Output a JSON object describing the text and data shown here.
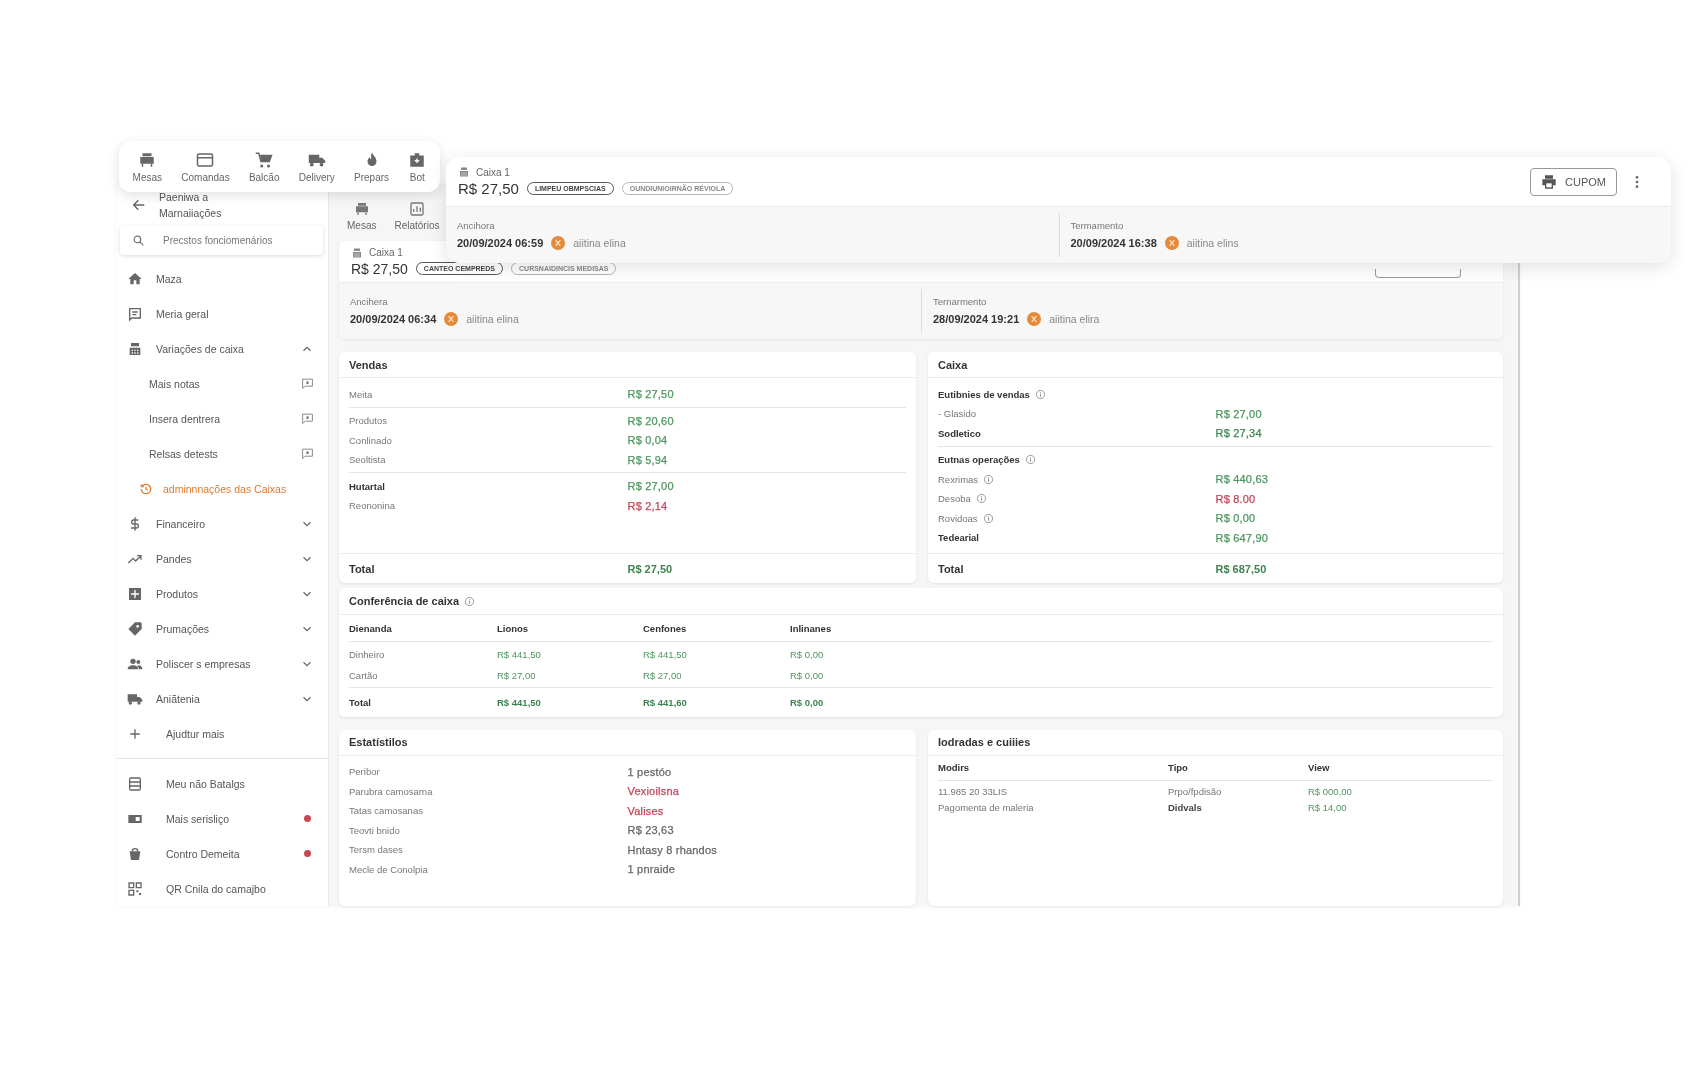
{
  "top_nav": {
    "items": [
      {
        "label": "Mesas"
      },
      {
        "label": "Comandas"
      },
      {
        "label": "Balcão"
      },
      {
        "label": "Delivery"
      },
      {
        "label": "Prepars"
      },
      {
        "label": "Bot"
      }
    ]
  },
  "cash_header": {
    "title": "Caixa 1",
    "amount": "R$ 27,50",
    "chips": [
      {
        "label": "LIMPEU OBMPSCIAS",
        "emphasis": true
      },
      {
        "label": "OUNDIUNIOIRNÃO RÉVIOLA",
        "emphasis": false
      }
    ],
    "print_button": "CUPOM",
    "opening": {
      "label": "Ancihora",
      "datetime": "20/09/2024 06:59",
      "user": "aiitina elina"
    },
    "closing": {
      "label": "Termamento",
      "datetime": "20/09/2024 16:38",
      "user": "aiitina elins"
    }
  },
  "sidebar": {
    "title": "Paeniwa a Marnaiiações",
    "search": {
      "placeholder": "Precstos fonciomenários"
    },
    "items": [
      {
        "kind": "link",
        "label": "Maza",
        "selected": false
      },
      {
        "kind": "link",
        "label": "Meria geral",
        "selected": false
      },
      {
        "kind": "group",
        "label": "Variações de caixa",
        "selected": false,
        "expanded": true,
        "children": [
          {
            "label": "Mais notas",
            "selected": false
          },
          {
            "label": "Insera dentrera",
            "selected": false
          },
          {
            "label": "Relsas detests",
            "selected": false
          },
          {
            "label": "adminnnações das Caixas",
            "selected": true
          }
        ]
      },
      {
        "kind": "group",
        "label": "Financeiro",
        "selected": false,
        "expanded": false
      },
      {
        "kind": "group",
        "label": "Pandes",
        "selected": false,
        "expanded": false
      },
      {
        "kind": "group",
        "label": "Produtos",
        "selected": false,
        "expanded": false
      },
      {
        "kind": "group",
        "label": "Prumações",
        "selected": false,
        "expanded": false
      },
      {
        "kind": "group",
        "label": "Poliscer s empresas",
        "selected": false,
        "expanded": false
      },
      {
        "kind": "group",
        "label": "Aniãtenia",
        "selected": false,
        "expanded": false
      },
      {
        "kind": "action",
        "label": "Ajudtur mais",
        "selected": false
      }
    ],
    "bottom_items": [
      {
        "label": "Meu não Batalgs",
        "alert": false
      },
      {
        "label": "Mais serisliço",
        "alert": true
      },
      {
        "label": "Contro Demeita",
        "alert": true
      },
      {
        "label": "QR Cnila do camajbo",
        "alert": false
      }
    ]
  },
  "sub_nav": {
    "items": [
      {
        "label": "Mesas"
      },
      {
        "label": "Relatórios"
      }
    ]
  },
  "cash_summary": {
    "title": "Caixa 1",
    "amount": "R$ 27,50",
    "chips": [
      {
        "label": "CANTEO CEMPREDS",
        "emphasis": true
      },
      {
        "label": "CURSNAIDINCIS MEDISAS",
        "emphasis": false
      }
    ],
    "opening": {
      "label": "Ancihera",
      "datetime": "20/09/2024 06:34",
      "user": "aiitina elina"
    },
    "closing": {
      "label": "Ternarmento",
      "datetime": "28/09/2024 19:21",
      "user": "aiitina elira"
    }
  },
  "sales": {
    "title": "Vendas",
    "groups": [
      {
        "rows": [
          {
            "kind": "row",
            "label": "Meita",
            "bold": false,
            "value": "R$ 27,50",
            "color": "#4f9560"
          }
        ]
      },
      {
        "rows": [
          {
            "kind": "row",
            "label": "Produtos",
            "bold": false,
            "value": "R$ 20,60",
            "color": "#4f9560"
          },
          {
            "kind": "row",
            "label": "Conlinado",
            "bold": false,
            "value": "R$ 0,04",
            "color": "#4f9560"
          },
          {
            "kind": "row",
            "label": "Seoltista",
            "bold": false,
            "value": "R$ 5,94",
            "color": "#4f9560"
          }
        ]
      },
      {
        "rows": [
          {
            "kind": "row",
            "label": "Hutartal",
            "bold": true,
            "value": "R$ 27,00",
            "color": "#4f9560"
          },
          {
            "kind": "row",
            "label": "Reononina",
            "bold": false,
            "value": "R$ 2,14",
            "color": "#c0485a"
          }
        ]
      }
    ],
    "total": {
      "label": "Total",
      "value": "R$ 27,50"
    }
  },
  "cash": {
    "title": "Caixa",
    "groups": [
      {
        "rows": [
          {
            "kind": "heading",
            "label": "Eutibnies de vendas",
            "info": true
          },
          {
            "kind": "row",
            "label": "- Glasido",
            "bold": false,
            "info": false,
            "value": "R$ 27,00",
            "color": "#4f9560"
          },
          {
            "kind": "row",
            "label": "Sodletico",
            "bold": true,
            "info": false,
            "value": "R$ 27,34",
            "color": "#3f8450"
          }
        ]
      },
      {
        "rows": [
          {
            "kind": "heading",
            "label": "Eutnas operações",
            "info": true
          },
          {
            "kind": "row",
            "label": "Rexrimas",
            "bold": false,
            "info": true,
            "value": "R$ 440,63",
            "color": "#4f9560"
          },
          {
            "kind": "row",
            "label": "Desoba",
            "bold": false,
            "info": true,
            "value": "R$ 8.00",
            "color": "#c0485a"
          },
          {
            "kind": "row",
            "label": "Rovidoas",
            "bold": false,
            "info": true,
            "value": "R$ 0,00",
            "color": "#4f9560"
          },
          {
            "kind": "row",
            "label": "Tedearial",
            "bold": true,
            "info": false,
            "value": "R$ 647,90",
            "color": "#4f9560"
          }
        ]
      }
    ],
    "total": {
      "label": "Total",
      "value": "R$ 687,50"
    }
  },
  "conference": {
    "title": "Conferência de caixa",
    "columns": [
      "Dienanda",
      "Lionos",
      "Cenfones",
      "Inlinanes"
    ],
    "rows": [
      [
        "Dinheiro",
        "R$ 441,50",
        "R$ 441,50",
        "R$ 0,00"
      ],
      [
        "Cartão",
        "R$ 27,00",
        "R$ 27,00",
        "R$ 0,00"
      ]
    ],
    "total": [
      "Total",
      "R$ 441,50",
      "R$ 441,60",
      "R$ 0,00"
    ]
  },
  "statistics": {
    "title": "Estatístilos",
    "groups": [
      {
        "rows": [
          {
            "kind": "row",
            "label": "Peribor",
            "bold": false,
            "value": "1 pestóo",
            "color": "#666666"
          },
          {
            "kind": "row",
            "label": "Parubra camosarna",
            "bold": false,
            "value": "Vexioilsna",
            "color": "#c0485a"
          },
          {
            "kind": "row",
            "label": "Tatas camosanas",
            "bold": false,
            "value": "Valises",
            "color": "#c0485a"
          },
          {
            "kind": "row",
            "label": "Teovti bnido",
            "bold": false,
            "value": "R$ 23,63",
            "color": "#666666"
          },
          {
            "kind": "row",
            "label": "Tersm dases",
            "bold": false,
            "value": "Hntasy 8 rhandos",
            "color": "#666666"
          },
          {
            "kind": "row",
            "label": "Mecle de Conolpia",
            "bold": false,
            "value": "1 pnraide",
            "color": "#666666"
          }
        ]
      }
    ]
  },
  "entries": {
    "title": "Iodradas e cuiiies",
    "columns": [
      "Modirs",
      "Tipo",
      "View"
    ],
    "rows": [
      [
        {
          "text": "11.985 20 33LIS",
          "kind": "label"
        },
        {
          "text": "Prpo/fpdisão",
          "kind": "label"
        },
        {
          "text": "R$ 000,00",
          "kind": "amount"
        }
      ],
      [
        {
          "text": "Pagomenta de maleria",
          "kind": "label"
        },
        {
          "text": "Didvals",
          "kind": "strong"
        },
        {
          "text": "R$ 14,00",
          "kind": "amount"
        }
      ]
    ]
  }
}
